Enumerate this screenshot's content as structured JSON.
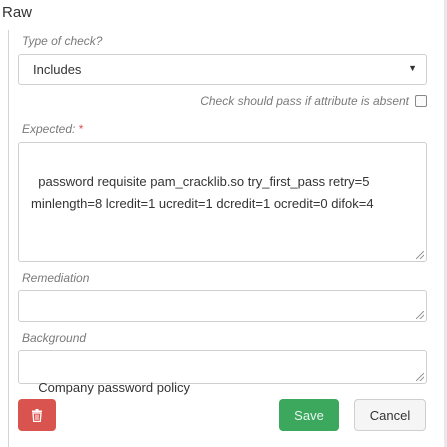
{
  "section": {
    "title": "Raw"
  },
  "type_of_check": {
    "label": "Type of check?",
    "selected": "Includes"
  },
  "absent_checkbox": {
    "label": "Check should pass if attribute is absent",
    "checked": false
  },
  "expected": {
    "label": "Expected:",
    "required_marker": "*",
    "value": "password requisite pam_cracklib.so try_first_pass retry=5 minlength=8 lcredit=1 ucredit=1 dcredit=1 ocredit=0 difok=4"
  },
  "remediation": {
    "label": "Remediation",
    "value": ""
  },
  "background": {
    "label": "Background",
    "value": "Company password policy"
  },
  "buttons": {
    "delete_icon": "trash-icon",
    "save_label": "Save",
    "cancel_label": "Cancel"
  },
  "colors": {
    "delete": "#d9534f",
    "save": "#3ba85e",
    "required": "#d9534f"
  }
}
